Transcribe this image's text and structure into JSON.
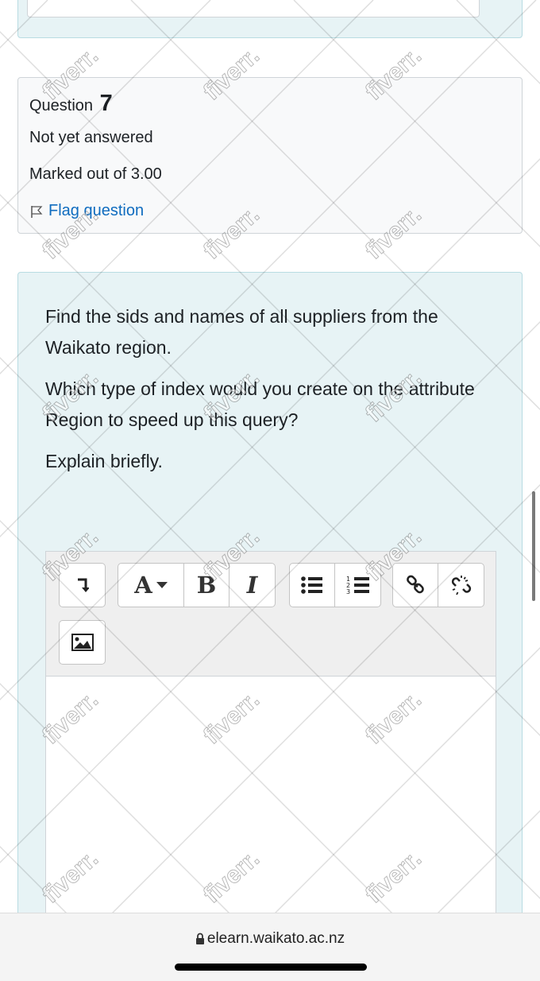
{
  "question_info": {
    "question_label": "Question",
    "question_number": "7",
    "state": "Not yet answered",
    "grade": "Marked out of 3.00",
    "flag_label": "Flag question"
  },
  "question_text": {
    "paragraphs": [
      "Find the sids and names of all suppliers from the Waikato region.",
      "Which type of index would you create on the attribute Region to speed up this query?",
      "Explain briefly."
    ]
  },
  "editor": {
    "toolbar_icons": [
      "show-more-icon",
      "paragraph-styles-icon",
      "bold-icon",
      "italic-icon",
      "unordered-list-icon",
      "ordered-list-icon",
      "link-icon",
      "unlink-icon",
      "insert-image-icon"
    ],
    "font_button_label": "A",
    "bold_label": "B",
    "italic_label": "I",
    "answer_value": ""
  },
  "browser": {
    "url": "elearn.waikato.ac.nz"
  },
  "watermark": {
    "text": "fiverr."
  },
  "colors": {
    "link": "#0f6cbf",
    "content_bg": "#e7f3f5",
    "info_bg": "#f8f9fa"
  }
}
